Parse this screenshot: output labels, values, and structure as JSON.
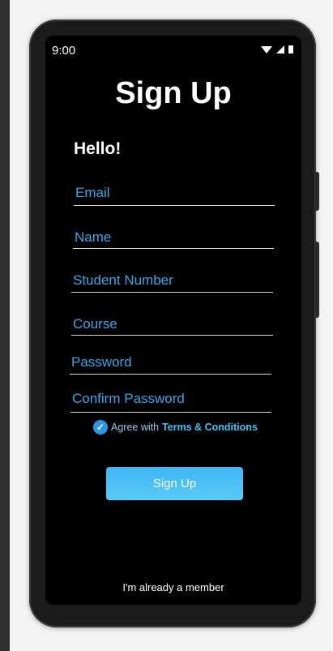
{
  "status_bar": {
    "time": "9:00",
    "icons": [
      "wifi-icon",
      "signal-icon",
      "battery-icon"
    ]
  },
  "screen": {
    "title": "Sign Up",
    "greeting": "Hello!",
    "fields": [
      {
        "label": "Email"
      },
      {
        "label": "Name"
      },
      {
        "label": "Student Number"
      },
      {
        "label": "Course"
      },
      {
        "label": "Password"
      },
      {
        "label": "Confirm Password"
      }
    ],
    "agree": {
      "checked": true,
      "text": "Agree with",
      "link": "Terms & Conditions"
    },
    "signup_button": "Sign Up",
    "member_link": "I'm already a member"
  },
  "colors": {
    "accent": "#38a6e8",
    "button": "#4ac0f5",
    "background": "#000000"
  }
}
